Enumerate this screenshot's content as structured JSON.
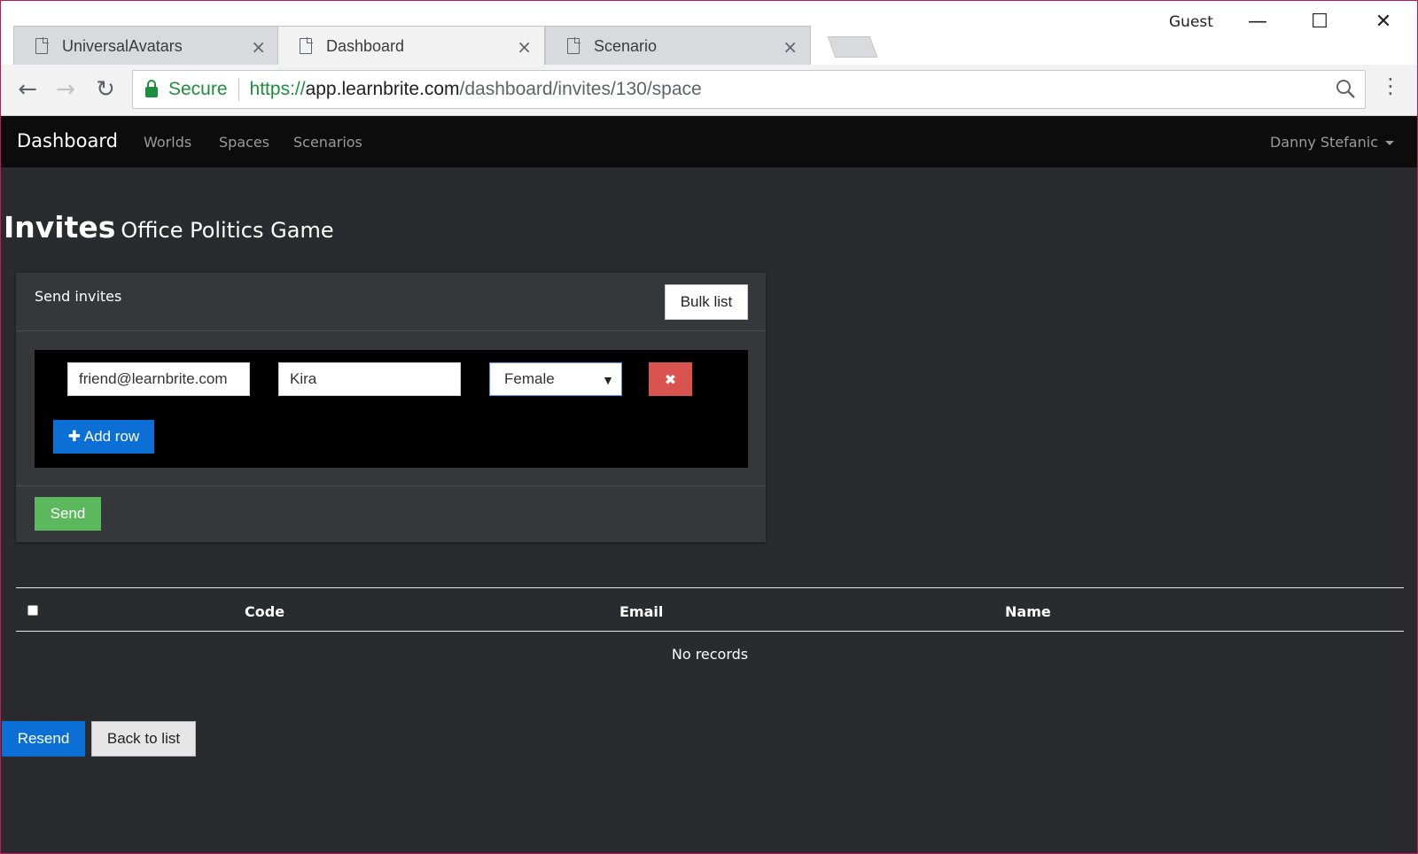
{
  "browser": {
    "tabs": [
      {
        "title": "UniversalAvatars",
        "close": "×"
      },
      {
        "title": "Dashboard",
        "close": "×"
      },
      {
        "title": "Scenario",
        "close": "×"
      }
    ],
    "profile": "Guest",
    "window_controls": {
      "minimize": "—",
      "maximize": "☐",
      "close": "✕"
    },
    "nav": {
      "back": "←",
      "forward": "→",
      "reload": "↻"
    },
    "secure_label": "Secure",
    "url": {
      "scheme": "https://",
      "host": "app.learnbrite.com",
      "path": "/dashboard/invites/130/space"
    },
    "menu": "⋮"
  },
  "navbar": {
    "brand": "Dashboard",
    "links": [
      "Worlds",
      "Spaces",
      "Scenarios"
    ],
    "user": "Danny Stefanic"
  },
  "page": {
    "title": "Invites",
    "subtitle": "Office Politics Game"
  },
  "invite_panel": {
    "heading": "Send invites",
    "bulk_label": "Bulk list",
    "row": {
      "email": "friend@learnbrite.com",
      "name": "Kira",
      "gender": "Female",
      "remove_icon": "✖"
    },
    "add_row_label": "✚ Add row",
    "send_label": "Send"
  },
  "table": {
    "columns": [
      "Code",
      "Email",
      "Name"
    ],
    "empty_text": "No records"
  },
  "actions": {
    "resend": "Resend",
    "back": "Back to list"
  },
  "colors": {
    "page_bg": "#2a2b2e",
    "navbar_bg": "#0c0c0d",
    "primary": "#0b6fd6",
    "success": "#5cb85c",
    "danger": "#d9534f",
    "secure_green": "#1e8e3e"
  }
}
